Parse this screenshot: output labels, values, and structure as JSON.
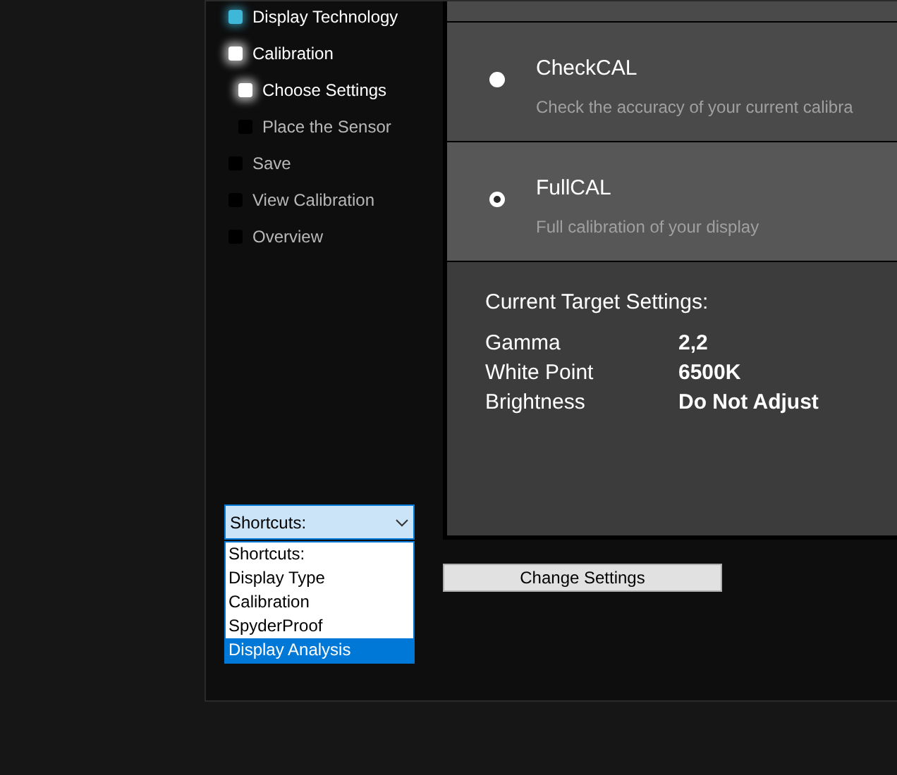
{
  "steps": [
    {
      "label": "Display Technology",
      "kind": "done"
    },
    {
      "label": "Calibration",
      "kind": "current",
      "children": [
        {
          "label": "Choose Settings",
          "kind": "current"
        },
        {
          "label": "Place the Sensor",
          "kind": "pending"
        }
      ]
    },
    {
      "label": "Save",
      "kind": "pending"
    },
    {
      "label": "View Calibration",
      "kind": "pending"
    },
    {
      "label": "Overview",
      "kind": "pending"
    }
  ],
  "options": [
    {
      "title": "CheckCAL",
      "description": "Check the accuracy of your current calibra",
      "selected": false
    },
    {
      "title": "FullCAL",
      "description": "Full calibration of your display",
      "selected": true
    }
  ],
  "target_settings": {
    "heading": "Current Target Settings:",
    "rows": [
      {
        "label": "Gamma",
        "value": "2,2"
      },
      {
        "label": "White Point",
        "value": "6500K"
      },
      {
        "label": "Brightness",
        "value": "Do Not Adjust"
      }
    ]
  },
  "shortcuts": {
    "value": "Shortcuts:",
    "expanded": true,
    "items": [
      {
        "label": "Shortcuts:",
        "highlighted": false
      },
      {
        "label": "Display Type",
        "highlighted": false
      },
      {
        "label": "Calibration",
        "highlighted": false
      },
      {
        "label": "SpyderProof",
        "highlighted": false
      },
      {
        "label": "Display Analysis",
        "highlighted": true
      }
    ]
  },
  "change_settings_button": "Change Settings"
}
